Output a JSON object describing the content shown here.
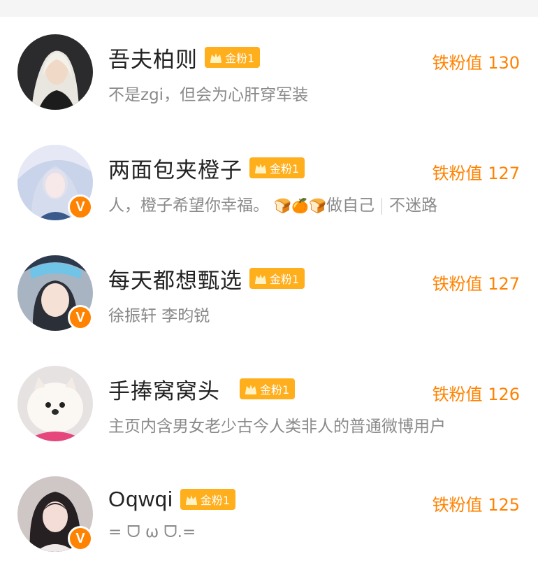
{
  "badge_label": "金粉1",
  "verified_mark": "V",
  "colors": {
    "accent": "#ff8200",
    "badge_bg": "#ffae1c",
    "name": "#222222",
    "bio": "#8a8a8a"
  },
  "fans": [
    {
      "name": "吾夫柏则",
      "bio": "不是zgi，但会为心肝穿军装",
      "score": "铁粉值 130",
      "verified": false
    },
    {
      "name": "两面包夹橙子",
      "bio_a": "人，橙子希望你幸福。",
      "bio_emoji": "🍞🍊🍞",
      "bio_b": "做自己",
      "bio_c": "不迷路",
      "score": "铁粉值 127",
      "verified": true
    },
    {
      "name": "每天都想甄选",
      "bio": "徐振轩 李昀锐",
      "score": "铁粉值 127",
      "verified": true
    },
    {
      "name": "手捧窝窝头",
      "bio": "主页内含男女老少古今人类非人的普通微博用户",
      "score": "铁粉值 126",
      "verified": false
    },
    {
      "name": "Oqwqi",
      "bio": "= ᗜ ω ᗜ.=",
      "score": "铁粉值 125",
      "verified": true
    }
  ]
}
